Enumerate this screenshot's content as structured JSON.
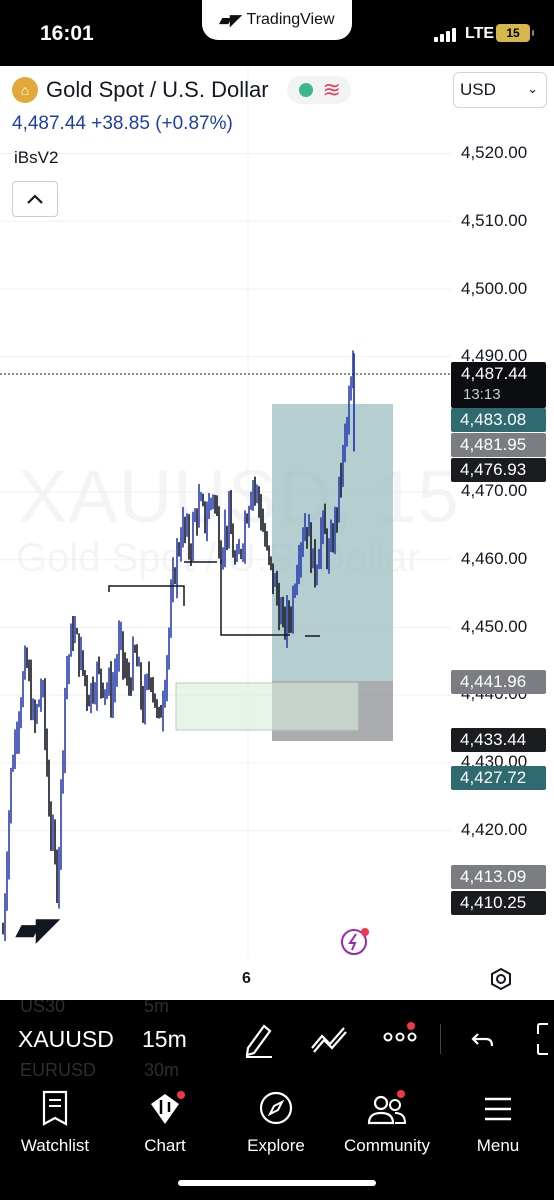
{
  "status_bar": {
    "time": "16:01",
    "app_banner": "TradingView",
    "network": "LTE",
    "battery": "15"
  },
  "header": {
    "symbol_name": "Gold Spot / U.S. Dollar",
    "price": "4,487.44",
    "change": "+38.85",
    "change_pct": "(+0.87%)",
    "indicator": "iBsV2",
    "currency": "USD"
  },
  "watermark": {
    "symbol": "XAUUSD, 15",
    "description": "Gold Spot / U.S. Dollar"
  },
  "price_axis": [
    "4,520.00",
    "4,510.00",
    "4,500.00",
    "4,490.00",
    "4,470.00",
    "4,460.00",
    "4,450.00",
    "4,440.00",
    "4,430.00",
    "4,420.00"
  ],
  "price_tags": {
    "current": {
      "price": "4,487.44",
      "countdown": "13:13",
      "color": "#0c0d10"
    },
    "tag_4483": {
      "label": "4,483.08",
      "color": "#2e6a6f"
    },
    "tag_4481": {
      "label": "4,481.95",
      "color": "#7b7d83"
    },
    "tag_4476": {
      "label": "4,476.93",
      "color": "#1b1c20"
    },
    "tag_4441": {
      "label": "4,441.96",
      "color": "#7b7d83"
    },
    "tag_4433": {
      "label": "4,433.44",
      "color": "#1b1c20"
    },
    "tag_4427": {
      "label": "4,427.72",
      "color": "#2e6a6f"
    },
    "tag_4413": {
      "label": "4,413.09",
      "color": "#7b7d83"
    },
    "tag_4410": {
      "label": "4,410.25",
      "color": "#1b1c20"
    }
  },
  "time_axis": {
    "date_label": "6"
  },
  "chart_data": {
    "type": "candlestick",
    "symbol": "XAUUSD",
    "interval": "15m",
    "last_price": 4487.44,
    "ylim": [
      4407,
      4525
    ],
    "y_ticks": [
      4420,
      4430,
      4440,
      4450,
      4460,
      4470,
      4490,
      4500,
      4510,
      4520
    ],
    "x_tick_labels": [
      "6"
    ],
    "profit_zone": {
      "from": 4441.96,
      "to": 4483.08
    },
    "loss_zone": {
      "from": 4433.44,
      "to": 4441.96
    },
    "range_box": {
      "from": 4435,
      "to": 4442
    },
    "structure_levels": [
      4456,
      4455,
      4457,
      4449,
      4449
    ],
    "close_path": [
      4405,
      4428,
      4438,
      4445,
      4435,
      4442,
      4422,
      4412,
      4442,
      4450,
      4445,
      4440,
      4443,
      4442,
      4440,
      4448,
      4441,
      4446,
      4438,
      4444,
      4435,
      4445,
      4458,
      4465,
      4462,
      4468,
      4466,
      4470,
      4462,
      4466,
      4458,
      4465,
      4472,
      4468,
      4460,
      4456,
      4450,
      4452,
      4462,
      4466,
      4458,
      4465,
      4460,
      4468,
      4478,
      4487
    ]
  },
  "toolbar": {
    "ghost_top_symbol": "US30",
    "ghost_top_interval": "5m",
    "symbol": "XAUUSD",
    "interval": "15m",
    "ghost_bottom_symbol": "EURUSD",
    "ghost_bottom_interval": "30m",
    "icons": [
      "drawing-tools-icon",
      "indicators-icon",
      "more-icon",
      "undo-icon",
      "fullscreen-icon"
    ]
  },
  "bottom_nav": {
    "items": [
      {
        "label": "Watchlist",
        "icon": "watchlist-icon"
      },
      {
        "label": "Chart",
        "icon": "chart-icon"
      },
      {
        "label": "Explore",
        "icon": "compass-icon"
      },
      {
        "label": "Community",
        "icon": "community-icon"
      },
      {
        "label": "Menu",
        "icon": "menu-icon"
      }
    ]
  }
}
